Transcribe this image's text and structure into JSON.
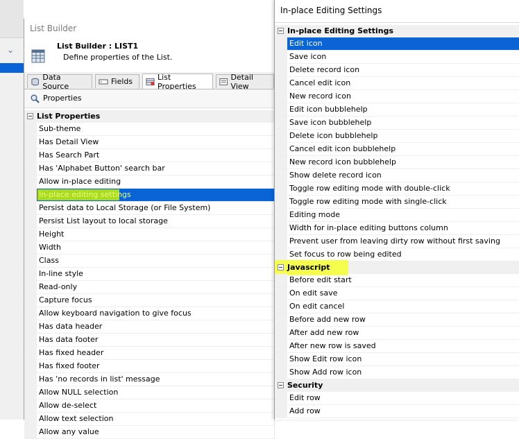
{
  "list_builder": {
    "window_title": "List Builder",
    "header_title": "List Builder : LIST1",
    "header_subtitle": "Define properties of the List.",
    "tabs": [
      {
        "label": "Data Source",
        "icon": "data-source-icon",
        "active": false
      },
      {
        "label": "Fields",
        "icon": "fields-icon",
        "active": false
      },
      {
        "label": "List Properties",
        "icon": "list-properties-icon",
        "active": true
      },
      {
        "label": "Detail View",
        "icon": "detail-view-icon",
        "active": false
      }
    ],
    "properties_label": "Properties",
    "section_title": "List Properties",
    "items": [
      "Sub-theme",
      "Has Detail View",
      "Has Search Part",
      "Has 'Alphabet Button' search bar",
      "Allow in-place editing",
      "In-place editing settings",
      "Persist data to Local Storage (or File System)",
      "Persist List layout to local storage",
      "Height",
      "Width",
      "Class",
      "In-line style",
      "Read-only",
      "Capture focus",
      "Allow keyboard navigation to give focus",
      "Has data header",
      "Has data footer",
      "Has fixed header",
      "Has fixed footer",
      "Has 'no records in list' message",
      "Allow NULL selection",
      "Allow de-select",
      "Allow text selection",
      "Allow any value"
    ],
    "selected_index": 5
  },
  "settings": {
    "title": "In-place Editing Settings",
    "sections": [
      {
        "title": "In-place Editing Settings",
        "items": [
          "Edit icon",
          "Save icon",
          "Delete record icon",
          "Cancel edit icon",
          "New record icon",
          "Edit icon bubblehelp",
          "Save icon bubblehelp",
          "Delete icon bubblehelp",
          "Cancel edit icon bubblehelp",
          "New record icon bubblehelp",
          "Show delete record icon",
          "Toggle row editing mode with double-click",
          "Toggle row editing mode with single-click",
          "Editing mode",
          "Width for in-place editing buttons column",
          "Prevent user from leaving dirty row without first saving",
          "Set focus to row being edited"
        ]
      },
      {
        "title": "Javascript",
        "items": [
          "Before edit start",
          "On edit save",
          "On edit cancel",
          "Before add new row",
          "After add new row",
          "After new row is saved",
          "Show Edit row icon",
          "Show Add row icon"
        ]
      },
      {
        "title": "Security",
        "items": [
          "Edit row",
          "Add row"
        ]
      }
    ],
    "selected": "Edit icon"
  },
  "colors": {
    "selection_blue": "#0a64d6",
    "highlight_yellow": "#f5ff3a",
    "highlight_lime": "#c8f000"
  }
}
